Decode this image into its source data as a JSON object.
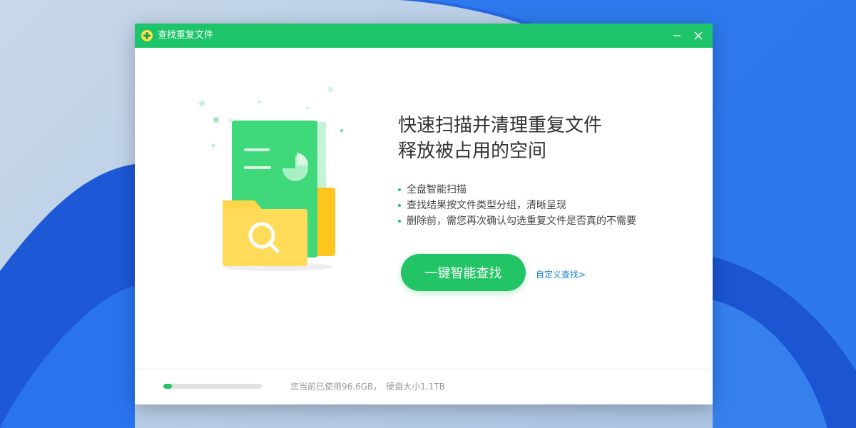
{
  "window": {
    "title": "查找重复文件"
  },
  "headline": {
    "line1": "快速扫描并清理重复文件",
    "line2": "释放被占用的空间"
  },
  "features": [
    "全盘智能扫描",
    "查找结果按文件类型分组，清晰呈现",
    "删除前，需您再次确认勾选重复文件是否真的不需要"
  ],
  "actions": {
    "scan_button_label": "一键智能查找",
    "custom_search_link": "自定义查找>"
  },
  "disk": {
    "used_text": "您当前已使用96.6GB，",
    "total_text": "硬盘大小1.1TB",
    "usage_fraction": 0.086
  },
  "colors": {
    "accent": "#22c466",
    "titlebar": "#1ec46a",
    "link": "#1a7fd4",
    "folder": "#ffd54a"
  },
  "icons": {
    "app": "broom-plus-icon",
    "minimize": "minimize-icon",
    "close": "close-icon",
    "search": "magnifier-icon"
  }
}
